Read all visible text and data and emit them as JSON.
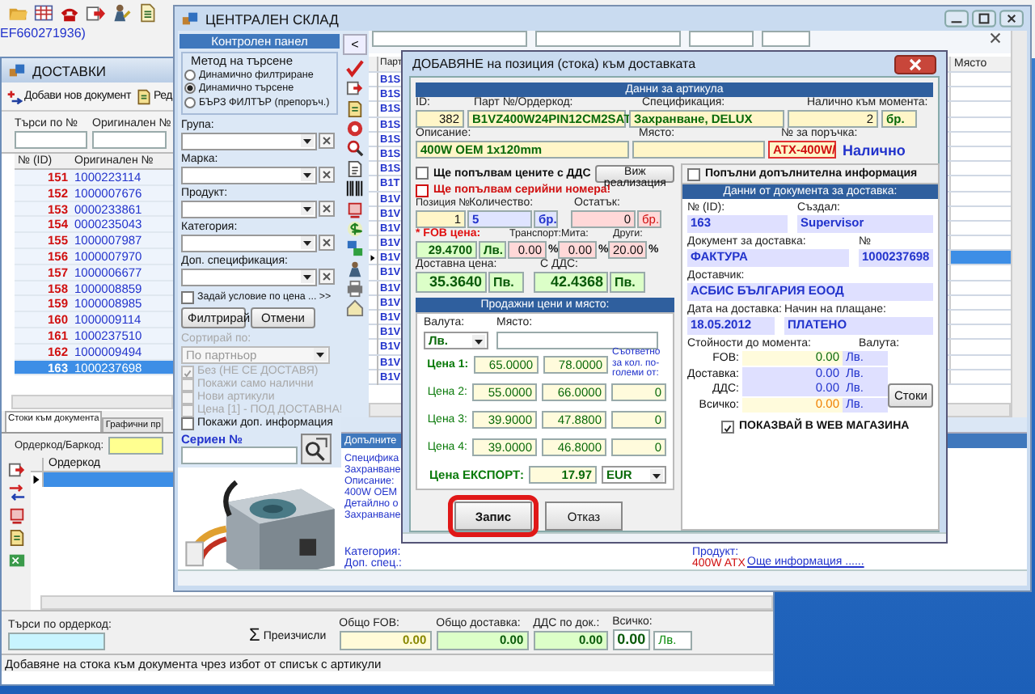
{
  "app": {
    "reference": "EF660271936)"
  },
  "deliveries": {
    "title": "ДОСТАВКИ",
    "toolbar": [
      "Добави нов документ",
      "Ред"
    ],
    "search": [
      {
        "label": "Търси по №"
      },
      {
        "label": "Оригинален №"
      }
    ],
    "columns": [
      "№ (ID)",
      "Оригинален №"
    ],
    "rows": [
      {
        "id": "151",
        "original": "1000223114",
        "selected": false
      },
      {
        "id": "152",
        "original": "1000007676",
        "selected": false
      },
      {
        "id": "153",
        "original": "0000233861",
        "selected": false
      },
      {
        "id": "154",
        "original": "0000235043",
        "selected": false
      },
      {
        "id": "155",
        "original": "1000007987",
        "selected": false
      },
      {
        "id": "156",
        "original": "1000007970",
        "selected": false
      },
      {
        "id": "157",
        "original": "1000006677",
        "selected": false
      },
      {
        "id": "158",
        "original": "1000008859",
        "selected": false
      },
      {
        "id": "159",
        "original": "1000008985",
        "selected": false
      },
      {
        "id": "160",
        "original": "1000009114",
        "selected": false
      },
      {
        "id": "161",
        "original": "1000237510",
        "selected": false
      },
      {
        "id": "162",
        "original": "1000009494",
        "selected": false
      },
      {
        "id": "163",
        "original": "1000237698",
        "selected": true
      }
    ],
    "tabs": [
      {
        "label": "Стоки към документа",
        "selected": true
      },
      {
        "label": "Графични пр",
        "selected": false
      }
    ],
    "barcode": {
      "label": "Ордеркод/Баркод:"
    },
    "items": {
      "columns": [
        "Ордеркод"
      ]
    },
    "barcode_search": {
      "label": "Търси по ордеркод:"
    },
    "recalculate": {
      "icon": "Σ",
      "label": "Преизчисли"
    },
    "totals": [
      {
        "label": "Общо FOB:",
        "value": "0.00",
        "kind": "fob"
      },
      {
        "label": "Общо доставка:",
        "value": "0.00",
        "kind": "plain"
      },
      {
        "label": "ДДС по док.:",
        "value": "0.00",
        "kind": "plain"
      },
      {
        "label": "Всичко:",
        "value": "0.00",
        "kind": "grand"
      }
    ],
    "total_currency": "Лв.",
    "status_bar": "Добавяне на стока към документа чрез избот от списък с артикули"
  },
  "central": {
    "title": "ЦЕНТРАЛЕН СКЛАД",
    "panel": {
      "header": "Контролен панел",
      "method_label": "Метод на търсене",
      "methods": [
        {
          "label": "Динамично филтриране",
          "selected": false
        },
        {
          "label": "Динамично търсене",
          "selected": true
        },
        {
          "label": "БЪРЗ ФИЛТЪР (препоръч.)",
          "selected": false
        }
      ],
      "filters": [
        {
          "label": "Група:"
        },
        {
          "label": "Марка:"
        },
        {
          "label": "Продукт:"
        },
        {
          "label": "Категория:"
        },
        {
          "label": "Доп. спецификация:"
        }
      ],
      "price_condition": {
        "label": "Задай условие по цена ... >>",
        "checked": false
      },
      "buttons": [
        "Филтрирай",
        "Отмени"
      ],
      "sort": {
        "label": "Сортирай по:",
        "value": "По партньор",
        "disabled": true
      },
      "options": [
        {
          "label": "Без (НЕ СЕ ДОСТАВЯ)",
          "checked": true,
          "disabled": true
        },
        {
          "label": "Покажи само налични",
          "checked": false,
          "disabled": true
        },
        {
          "label": "Нови артикули",
          "checked": false,
          "disabled": true
        },
        {
          "label": "Цена [1] - ПОД ДОСТАВНА!",
          "checked": false,
          "disabled": true
        },
        {
          "label": "Покажи доп. информация",
          "checked": false,
          "disabled": false
        }
      ],
      "serial": {
        "label": "Сериен №"
      }
    },
    "collapse": "<",
    "table": {
      "columns": [
        "Парт",
        "Място"
      ],
      "rows": [
        {
          "part": "B1S",
          "selected": false
        },
        {
          "part": "B1S",
          "selected": false
        },
        {
          "part": "B1S",
          "selected": false
        },
        {
          "part": "B1S",
          "selected": false
        },
        {
          "part": "B1S",
          "selected": false
        },
        {
          "part": "B1S",
          "selected": false
        },
        {
          "part": "B1S",
          "selected": false
        },
        {
          "part": "B1T",
          "selected": false
        },
        {
          "part": "B1V",
          "selected": false
        },
        {
          "part": "B1V",
          "selected": false
        },
        {
          "part": "B1V",
          "selected": false
        },
        {
          "part": "B1V",
          "selected": false
        },
        {
          "part": "B1V",
          "selected": true
        },
        {
          "part": "B1V",
          "selected": false
        },
        {
          "part": "B1V",
          "selected": false
        },
        {
          "part": "B1V",
          "selected": false
        },
        {
          "part": "B1V",
          "selected": false
        },
        {
          "part": "B1V",
          "selected": false
        },
        {
          "part": "B1V",
          "selected": false
        },
        {
          "part": "B1V",
          "selected": false
        },
        {
          "part": "B1V",
          "selected": false
        }
      ]
    },
    "details": {
      "header": "Допълните",
      "lines": [
        "Специфика",
        "Захранване",
        "Описание:",
        "400W OEM",
        "Детайлно о",
        "Захранване"
      ],
      "category_label": "Категория:",
      "extra_label": "Доп. спец.:",
      "product_label": "Продукт:",
      "product_value": "400W ATX",
      "link": "Още информация ......"
    }
  },
  "dialog": {
    "title": "ДОБАВЯНЕ на позиция (стока) към доставката",
    "article_header": "Данни за артикула",
    "id": {
      "label": "ID:",
      "value": "382"
    },
    "part": {
      "label": "Парт №/Ордеркод:",
      "value": "B1VZ400W24PIN12CM2SAT"
    },
    "spec": {
      "label": "Спецификация:",
      "value": "Захранване, DELUX"
    },
    "stock": {
      "label": "Налично към момента:",
      "value": "2",
      "unit": "бр."
    },
    "description": {
      "label": "Описание:",
      "value": "400W OEM 1x120mm"
    },
    "place": {
      "label": "Място:"
    },
    "order": {
      "label": "№ за поръчка:",
      "value": "ATX-400W/"
    },
    "availability": "Налично",
    "vat_prices": {
      "label": "Ще попълвам цените с ДДС",
      "checked": false
    },
    "sales_button": "Виж реализация",
    "serials": {
      "label": "Ще попълвам серийни номера!",
      "checked": false
    },
    "extra_info": {
      "label": "Попълни допълнителна информация",
      "checked": false
    },
    "position": {
      "label": "Позиция №",
      "value": "1"
    },
    "quantity": {
      "label": "Количество:",
      "value": "5",
      "unit": "бр."
    },
    "remainder": {
      "label": "Остатък:",
      "value": "0",
      "unit": "бр."
    },
    "fob": {
      "label": "* FOB цена:",
      "value": "29.4700",
      "currency": "Лв."
    },
    "costs": [
      {
        "label": "Транспорт:",
        "value": "0.00",
        "unit": "%"
      },
      {
        "label": "Мита:",
        "value": "0.00",
        "unit": "%"
      },
      {
        "label": "Други:",
        "value": "20.00",
        "unit": "%"
      }
    ],
    "delivery_price": {
      "label": "Доставна цена:",
      "value": "35.3640",
      "currency": "Пв."
    },
    "with_vat": {
      "label": "С ДДС:",
      "value": "42.4368",
      "currency": "Пв."
    },
    "sales_header": "Продажни цени и място:",
    "currency": {
      "label": "Валута:",
      "value": "Лв."
    },
    "sale_place": {
      "label": "Място:"
    },
    "qty_note": "Съответно за кол. по-големи от:",
    "prices": [
      {
        "label": "Цена 1:",
        "net": "65.0000",
        "gross": "78.0000",
        "primary": true
      },
      {
        "label": "Цена 2:",
        "net": "55.0000",
        "gross": "66.0000",
        "min_qty": "0",
        "primary": false
      },
      {
        "label": "Цена 3:",
        "net": "39.9000",
        "gross": "47.8800",
        "min_qty": "0",
        "primary": false
      },
      {
        "label": "Цена 4:",
        "net": "39.0000",
        "gross": "46.8000",
        "min_qty": "0",
        "primary": false
      }
    ],
    "export": {
      "label": "Цена ЕКСПОРТ:",
      "value": "17.97",
      "currency": "EUR"
    },
    "buttons": [
      {
        "label": "Запис",
        "highlighted": true
      },
      {
        "label": "Отказ",
        "highlighted": false
      }
    ],
    "doc_header": "Данни от документа за доставка:",
    "doc_rows": [
      [
        {
          "label": "№ (ID):",
          "value": "163"
        },
        {
          "label": "Създал:",
          "value": "Supervisor"
        }
      ],
      [
        {
          "label": "Документ за доставка:",
          "value": "ФАКТУРА"
        },
        {
          "label": "№",
          "value": "1000237698"
        }
      ],
      [
        {
          "label": "Доставчик:",
          "value": "АСБИС БЪЛГАРИЯ ЕООД"
        }
      ],
      [
        {
          "label": "Дата на доставка:",
          "value": "18.05.2012"
        },
        {
          "label": "Начин на плащане:",
          "value": "ПЛАТЕНО"
        }
      ]
    ],
    "values_label": "Стойности до момента:",
    "values_currency_label": "Валута:",
    "values": [
      {
        "label": "FOB:",
        "value": "0.00",
        "currency": "Лв.",
        "kind": "fob"
      },
      {
        "label": "Доставка:",
        "value": "0.00",
        "currency": "Лв.",
        "kind": "plain"
      },
      {
        "label": "ДДС:",
        "value": "0.00",
        "currency": "Лв.",
        "kind": "plain"
      },
      {
        "label": "Всичко:",
        "value": "0.00",
        "currency": "Лв.",
        "kind": "total"
      }
    ],
    "goods_button": "Стоки",
    "web_shop": {
      "label": "ПОКАЗВАЙ В WEB МАГАЗИНА",
      "checked": true
    }
  }
}
